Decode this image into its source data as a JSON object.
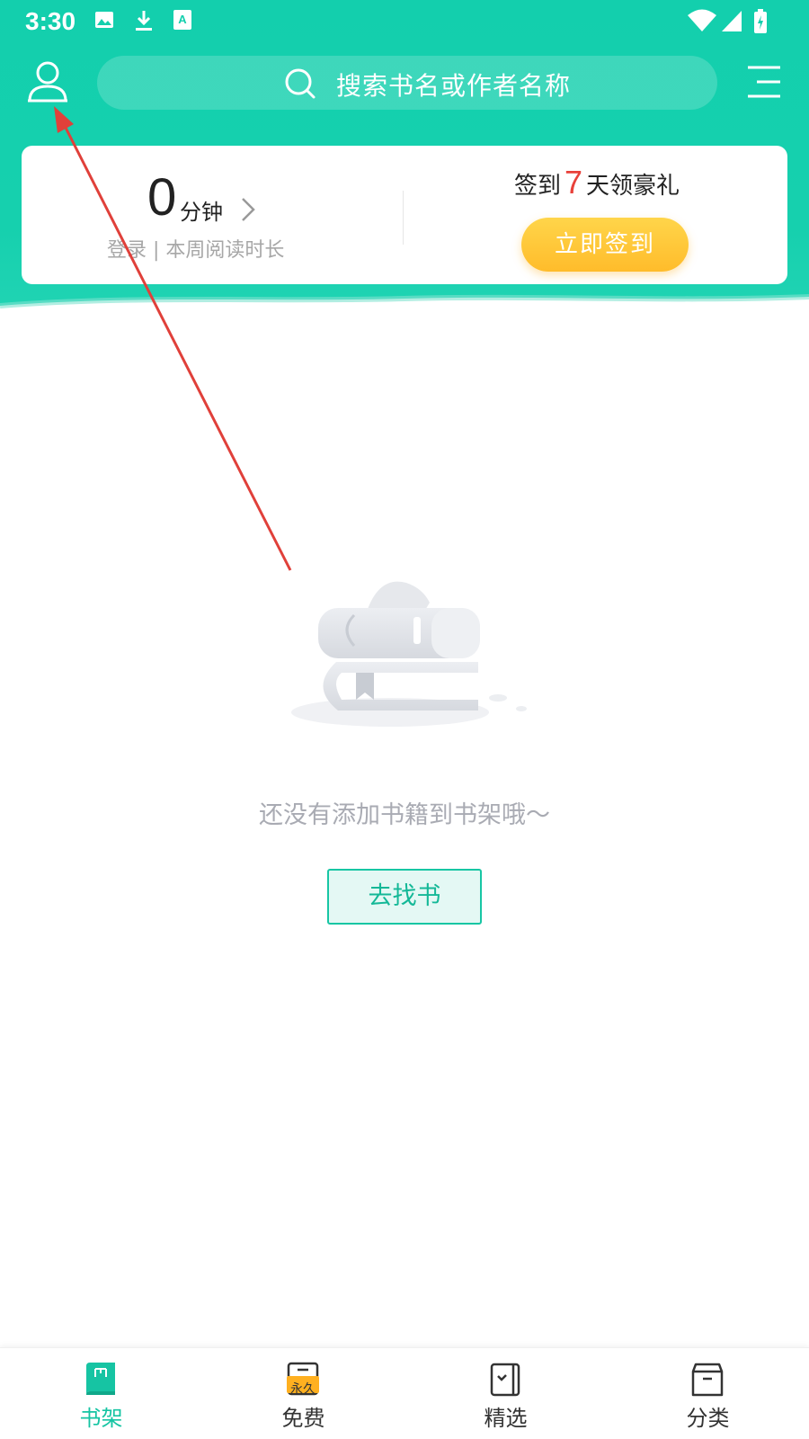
{
  "status_bar": {
    "time": "3:30"
  },
  "search": {
    "placeholder": "搜索书名或作者名称"
  },
  "reading_card": {
    "minutes_value": "0",
    "minutes_unit": "分钟",
    "subtitle": "登录 | 本周阅读时长",
    "checkin_prefix": "签到",
    "checkin_days": "7",
    "checkin_suffix": "天领豪礼",
    "checkin_button": "立即签到"
  },
  "empty_state": {
    "message": "还没有添加书籍到书架哦～",
    "button": "去找书"
  },
  "bottom_nav": {
    "items": [
      {
        "label": "书架",
        "icon": "bookshelf-icon",
        "active": true
      },
      {
        "label": "免费",
        "icon": "free-icon",
        "badge": "永久",
        "active": false
      },
      {
        "label": "精选",
        "icon": "featured-icon",
        "active": false
      },
      {
        "label": "分类",
        "icon": "category-icon",
        "active": false
      }
    ]
  },
  "colors": {
    "primary": "#16d0ae",
    "checkin_button": "#ffc633",
    "checkin_days": "#e8413a",
    "annotation_arrow": "#e0403a"
  }
}
